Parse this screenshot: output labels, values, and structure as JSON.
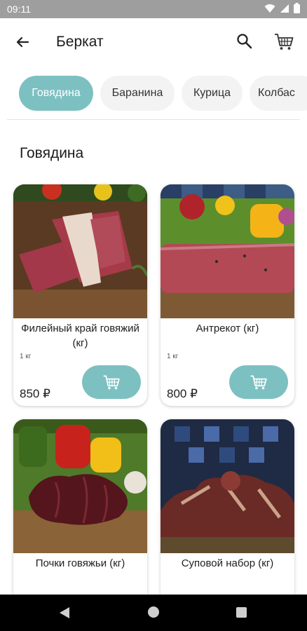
{
  "status": {
    "time": "09:11"
  },
  "appbar": {
    "title": "Беркат"
  },
  "chips": [
    "Говядина",
    "Баранина",
    "Курица",
    "Колбас"
  ],
  "section": {
    "title": "Говядина"
  },
  "products": [
    {
      "name": "Филейный край говяжий (кг)",
      "unit": "1 кг",
      "price": "850 ₽"
    },
    {
      "name": "Антрекот (кг)",
      "unit": "1 кг",
      "price": "800 ₽"
    },
    {
      "name": "Почки говяжьи (кг)"
    },
    {
      "name": "Суповой набор (кг)"
    }
  ],
  "colors": {
    "accent": "#7dc0c2",
    "statusbar": "#9e9e9e",
    "chip_bg": "#f3f3f3"
  },
  "icons": [
    "back-arrow-icon",
    "search-icon",
    "cart-icon",
    "add-to-cart-icon",
    "wifi-icon",
    "signal-icon",
    "battery-icon"
  ]
}
